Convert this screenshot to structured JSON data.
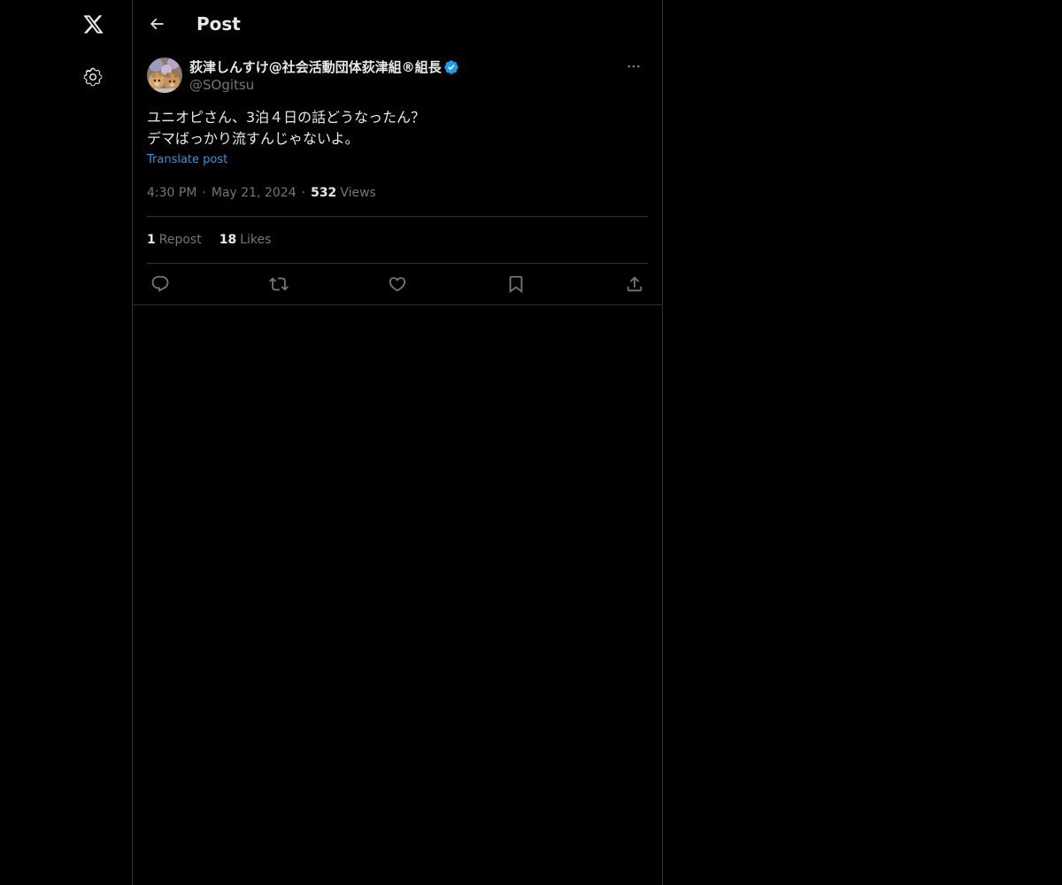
{
  "nav": {
    "logo_icon": "x-logo-icon",
    "settings_icon": "gear-icon"
  },
  "header": {
    "back_icon": "arrow-left-icon",
    "title": "Post"
  },
  "post": {
    "author": {
      "display_name": "荻津しんすけ@社会活動団体荻津組®組長",
      "handle": "@SOgitsu",
      "verified": true,
      "verified_color": "#1d9bf0"
    },
    "text_lines": [
      "ユニオピさん、3泊４日の話どうなったん？",
      "デマばっかり流すんじゃないよ。"
    ],
    "translate_label": "Translate post",
    "time": "4:30 PM",
    "separator": "·",
    "date": "May 21, 2024",
    "views_count": "532",
    "views_label": "Views",
    "reposts_count": "1",
    "reposts_label": "Repost",
    "likes_count": "18",
    "likes_label": "Likes"
  },
  "actions": [
    "reply-icon",
    "repost-icon",
    "like-icon",
    "bookmark-icon",
    "share-icon"
  ],
  "colors": {
    "background": "#000000",
    "text": "#e7e9ea",
    "muted": "#71767b",
    "border": "#2f3336",
    "accent": "#1d9bf0"
  }
}
